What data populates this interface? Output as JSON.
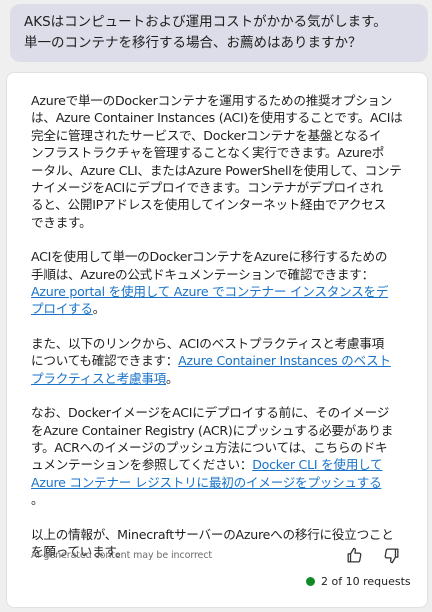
{
  "user_message": {
    "lines": [
      "AKSはコンピュートおよび運用コストがかかる気がします。",
      "単一のコンテナを移行する場合、お薦めはありますか？"
    ]
  },
  "response": {
    "p1": [
      "Azureで単一のDockerコンテナを運用するための推奨オプション",
      "は、Azure Container Instances (ACI)を使用することです。ACIは",
      "完全に管理されたサービスで、Dockerコンテナを基盤となるイ",
      "ンフラストラクチャを管理することなく実行できます。Azureポ",
      "ータル、Azure CLI、またはAzure PowerShellを使用して、コンテ",
      "ナイメージをACIにデプロイできます。コンテナがデプロイされ",
      "ると、公開IPアドレスを使用してインターネット経由でアクセス",
      "できます。"
    ],
    "p2": {
      "text_lines": [
        "ACIを使用して単一のDockerコンテナをAzureに移行するための",
        "手順は、Azureの公式ドキュメンテーションで確認できます："
      ],
      "link_lines": [
        "Azure portal を使用して Azure でコンテナー インスタンスをデ",
        "プロイする"
      ],
      "end": "。"
    },
    "p3": {
      "text_lines": [
        "また、以下のリンクから、ACIのベストプラクティスと考慮事項"
      ],
      "line2_text": "についても確認できます：",
      "line2_link": "Azure Container Instances のベスト",
      "line3_link": "プラクティスと考慮事項",
      "end": "。"
    },
    "p4": {
      "text_lines": [
        "なお、DockerイメージをACIにデプロイする前に、そのイメージ",
        "をAzure Container Registry (ACR)にプッシュする必要がありま",
        "す。ACRへのイメージのプッシュ方法については、こちらのドキ"
      ],
      "line4_text": "ュメンテーションを参照してください：",
      "line4_link": "Docker CLI を使用して",
      "line5_link": "Azure コンテナー レジストリに最初のイメージをプッシュする",
      "line6_end": "。"
    },
    "p5": [
      "以上の情報が、MinecraftサーバーのAzureへの移行に役立つこと",
      "を願っています。"
    ]
  },
  "footer": {
    "disclaimer": "AI-generated content may be incorrect",
    "requests_text": "2 of 10 requests",
    "status_color": "#0f8a27",
    "thumbs_up_icon": "thumbs-up-icon",
    "thumbs_down_icon": "thumbs-down-icon"
  }
}
